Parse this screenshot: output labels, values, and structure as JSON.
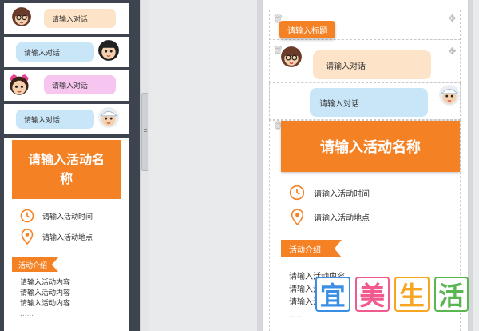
{
  "colors": {
    "accent": "#f58125",
    "sidebar": "#3d434f",
    "bubble_blue": "#c9e6f8",
    "bubble_peach": "#fde3c7",
    "bubble_pink": "#f7c6f0"
  },
  "sidebar": {
    "templates": [
      {
        "type": "dialog-left",
        "avatar": "girl-glasses-avatar",
        "text": "请输入对话",
        "bubble_color": "#fde3c7"
      },
      {
        "type": "dialog-right",
        "avatar": "boy-avatar",
        "text": "请输入对话",
        "bubble_color": "#c9e6f8"
      },
      {
        "type": "dialog-left",
        "avatar": "girl-pink-avatar",
        "text": "请输入对话",
        "bubble_color": "#f7c6f0"
      },
      {
        "type": "dialog-right",
        "avatar": "boy-hat-avatar",
        "text": "请输入对话",
        "bubble_color": "#c9e6f8"
      }
    ],
    "event_card": {
      "title": "请输入活动名称",
      "time_label": "请输入活动时间",
      "place_label": "请输入活动地点",
      "intro_tag": "活动介绍",
      "content_lines": [
        "请输入活动内容",
        "请输入活动内容",
        "请输入活动内容",
        "......"
      ]
    }
  },
  "canvas": {
    "title_tag": "请输入标题",
    "dialog_left": {
      "avatar": "girl-glasses-avatar",
      "text": "请输入对话"
    },
    "dialog_right": {
      "avatar": "boy-hat-avatar",
      "text": "请输入对话"
    },
    "event": {
      "title": "请输入活动名称",
      "time_label": "请输入活动时间",
      "place_label": "请输入活动地点",
      "intro_tag": "活动介绍",
      "content_lines": [
        "请输入活动内容",
        "请输入活动内容",
        "请输入活动内容",
        "......"
      ]
    }
  },
  "watermark": {
    "chars": [
      "宜",
      "美",
      "生",
      "活"
    ],
    "colors": [
      "#3a8ee6",
      "#f05a8e",
      "#f6a623",
      "#5ab651"
    ]
  }
}
